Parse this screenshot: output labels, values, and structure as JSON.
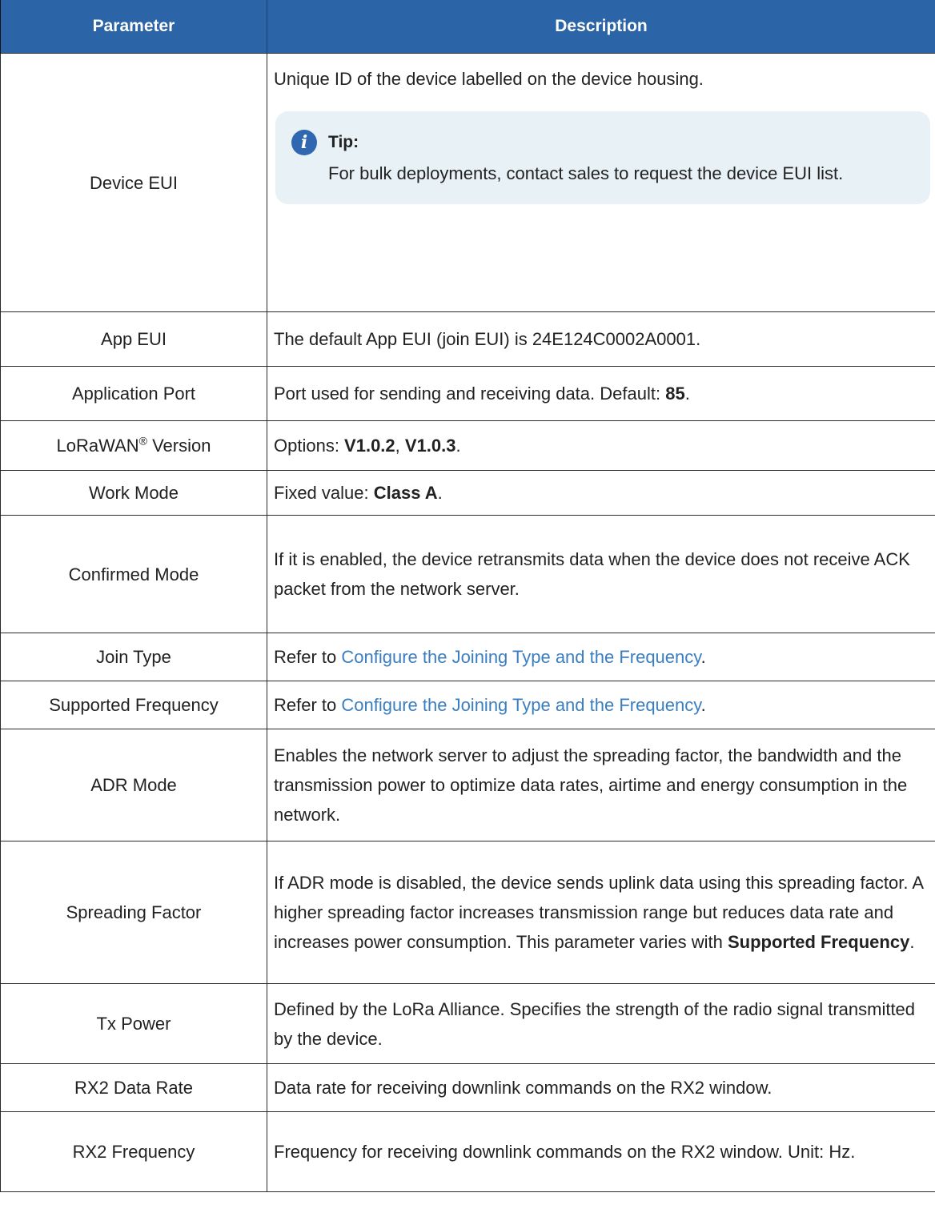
{
  "header": {
    "col1": "Parameter",
    "col2": "Description"
  },
  "rows": {
    "device_eui": {
      "param": "Device EUI",
      "desc": "Unique ID of the device labelled on the device housing.",
      "tip_title": "Tip:",
      "tip_body": "For bulk deployments, contact sales to request the device EUI list."
    },
    "app_eui": {
      "param": "App EUI",
      "desc": "The default App EUI (join EUI) is 24E124C0002A0001."
    },
    "app_port": {
      "param": "Application Port",
      "desc_prefix": "Port used for sending and receiving data. Default: ",
      "desc_bold": "85",
      "desc_suffix": "."
    },
    "lorawan_version": {
      "param_prefix": "LoRaWAN",
      "param_sup": "®",
      "param_suffix": " Version",
      "desc_prefix": "Options: ",
      "desc_bold1": "V1.0.2",
      "desc_sep": ", ",
      "desc_bold2": "V1.0.3",
      "desc_suffix": "."
    },
    "work_mode": {
      "param": "Work Mode",
      "desc_prefix": "Fixed value: ",
      "desc_bold": "Class A",
      "desc_suffix": "."
    },
    "confirmed_mode": {
      "param": "Confirmed Mode",
      "desc": "If it is enabled, the device retransmits data when the device does not receive ACK packet from the network server."
    },
    "join_type": {
      "param": "Join Type",
      "desc_prefix": "Refer to ",
      "link": "Configure the Joining Type and the Frequency",
      "desc_suffix": "."
    },
    "supported_frequency": {
      "param": "Supported Frequency",
      "desc_prefix": "Refer to ",
      "link": "Configure the Joining Type and the Frequency",
      "desc_suffix": "."
    },
    "adr_mode": {
      "param": "ADR Mode",
      "desc": "Enables the network server to adjust the spreading factor, the band­width and the transmission power to optimize data rates, airtime and energy consumption in the network."
    },
    "spreading_factor": {
      "param": "Spreading Factor",
      "desc_prefix": "If ADR mode is disabled, the device sends uplink data using this spreading factor. A higher spreading factor increases transmission range but reduces data rate and increases power consumption. This parameter varies with ",
      "desc_bold": "Supported Frequency",
      "desc_suffix": "."
    },
    "tx_power": {
      "param": "Tx Power",
      "desc": "Defined by the LoRa Alliance. Specifies the strength of the radio sig­nal transmitted by the device."
    },
    "rx2_data_rate": {
      "param": "RX2 Data Rate",
      "desc": "Data rate for receiving downlink commands on the RX2 window."
    },
    "rx2_frequency": {
      "param": "RX2 Frequency",
      "desc": "Frequency for receiving downlink commands on the RX2 window. Unit: Hz."
    }
  }
}
